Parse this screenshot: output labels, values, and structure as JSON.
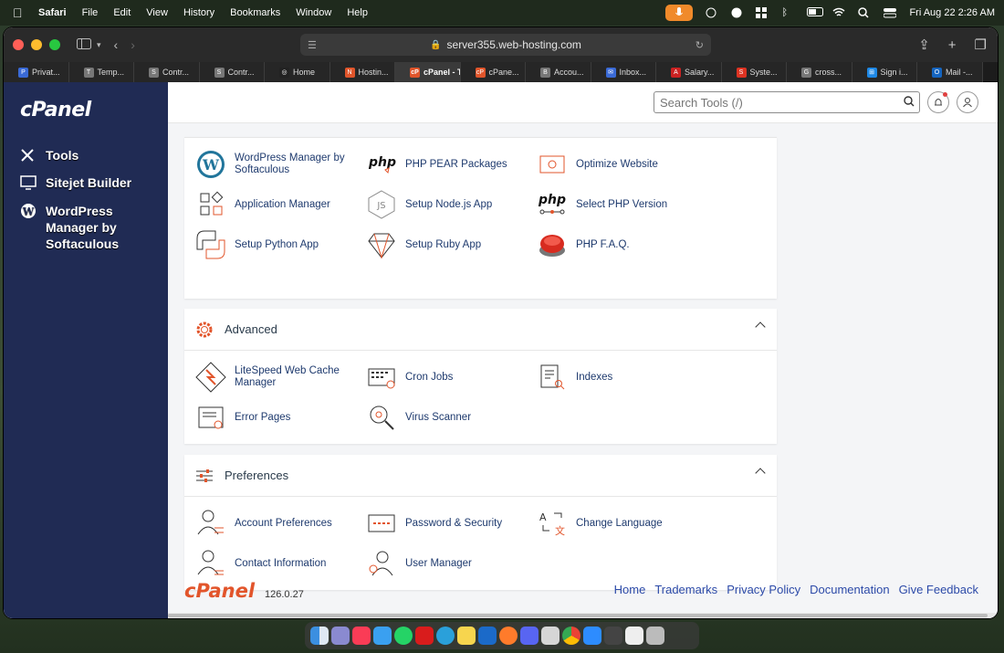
{
  "menubar": {
    "app": "Safari",
    "items": [
      "File",
      "Edit",
      "View",
      "History",
      "Bookmarks",
      "Window",
      "Help"
    ],
    "clock": "Fri Aug 22  2:26 AM"
  },
  "browser": {
    "url": "server355.web-hosting.com",
    "tabs": [
      {
        "label": "Privat...",
        "color": "#3a6ad6",
        "letter": "P"
      },
      {
        "label": "Temp...",
        "color": "#777777",
        "letter": "T"
      },
      {
        "label": "Contr...",
        "color": "#777777",
        "letter": "S"
      },
      {
        "label": "Contr...",
        "color": "#777777",
        "letter": "S"
      },
      {
        "label": "Home",
        "color": "#222222",
        "letter": "◎"
      },
      {
        "label": "Hostin...",
        "color": "#e0552b",
        "letter": "N"
      },
      {
        "label": "cPanel - To...",
        "color": "#e0552b",
        "letter": "cP",
        "active": true
      },
      {
        "label": "cPane...",
        "color": "#e0552b",
        "letter": "cP"
      },
      {
        "label": "Accou...",
        "color": "#777777",
        "letter": "B"
      },
      {
        "label": "Inbox...",
        "color": "#3a6ad6",
        "letter": "✉"
      },
      {
        "label": "Salary...",
        "color": "#cc2222",
        "letter": "A"
      },
      {
        "label": "Syste...",
        "color": "#dd3322",
        "letter": "S"
      },
      {
        "label": "cross...",
        "color": "#777777",
        "letter": "G"
      },
      {
        "label": "Sign i...",
        "color": "#1e88e5",
        "letter": "⊞"
      },
      {
        "label": "Mail -...",
        "color": "#1565c0",
        "letter": "O"
      }
    ]
  },
  "sidebar": {
    "logo": "cPanel",
    "items": [
      {
        "label": "Tools"
      },
      {
        "label": "Sitejet Builder"
      },
      {
        "label": "WordPress Manager by Softaculous"
      }
    ]
  },
  "topbar": {
    "search_placeholder": "Search Tools (/)"
  },
  "sections": {
    "software": {
      "tools": [
        {
          "label": "WordPress Manager by Softaculous"
        },
        {
          "label": "PHP PEAR Packages"
        },
        {
          "label": "Optimize Website"
        },
        {
          "label": "Application Manager"
        },
        {
          "label": "Setup Node.js App"
        },
        {
          "label": "Select PHP Version"
        },
        {
          "label": "Setup Python App"
        },
        {
          "label": "Setup Ruby App"
        },
        {
          "label": "PHP F.A.Q."
        }
      ]
    },
    "advanced": {
      "title": "Advanced",
      "tools": [
        {
          "label": "LiteSpeed Web Cache Manager"
        },
        {
          "label": "Cron Jobs"
        },
        {
          "label": "Indexes"
        },
        {
          "label": "Error Pages"
        },
        {
          "label": "Virus Scanner"
        }
      ]
    },
    "preferences": {
      "title": "Preferences",
      "tools": [
        {
          "label": "Account Preferences"
        },
        {
          "label": "Password & Security"
        },
        {
          "label": "Change Language"
        },
        {
          "label": "Contact Information"
        },
        {
          "label": "User Manager"
        }
      ]
    }
  },
  "footer": {
    "logo": "cPanel",
    "version": "126.0.27",
    "links": [
      "Home",
      "Trademarks",
      "Privacy Policy",
      "Documentation",
      "Give Feedback"
    ]
  },
  "colors": {
    "sidebar": "#202b54",
    "accent": "#e2552b",
    "link": "#2c4aa8"
  }
}
